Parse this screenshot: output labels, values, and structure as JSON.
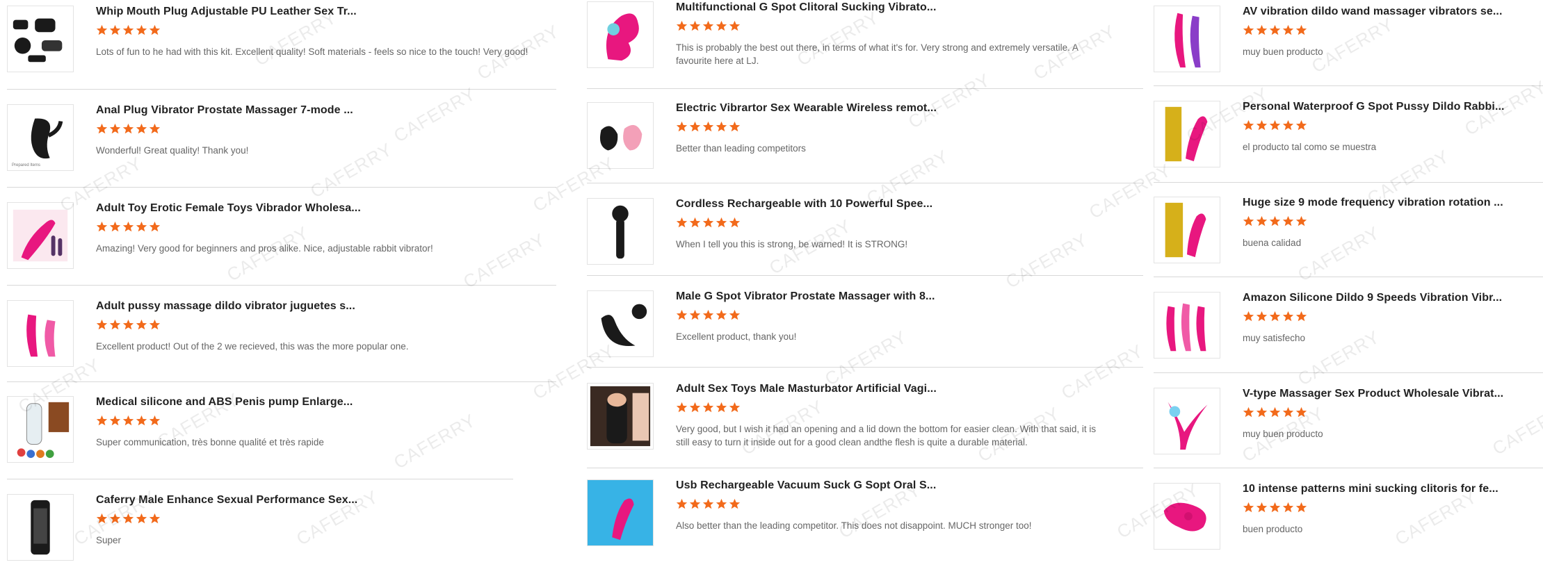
{
  "watermark_text": "CAFERRY",
  "star_color": "#f26a1b",
  "columns": [
    {
      "items": [
        {
          "title": "Whip Mouth Plug Adjustable PU Leather Sex Tr...",
          "rating": 5,
          "review": "Lots of fun to he had with this kit. Excellent quality! Soft materials - feels so nice to the touch! Very good!",
          "image": "black-restraint-kit"
        },
        {
          "title": "Anal Plug Vibrator Prostate Massager 7-mode ...",
          "rating": 5,
          "review": "Wonderful! Great quality! Thank you!",
          "image": "black-prostate-massager",
          "image_caption": "Prepared Items"
        },
        {
          "title": "Adult Toy Erotic Female Toys Vibrador Wholesa...",
          "rating": 5,
          "review": "Amazing! Very good for beginners and pros alike. Nice, adjustable rabbit vibrator!",
          "image": "pink-rabbit-vibrator"
        },
        {
          "title": "Adult pussy massage dildo vibrator juguetes s...",
          "rating": 5,
          "review": "Excellent product! Out of the 2 we recieved, this was the more popular one.",
          "image": "pink-dual-vibrator"
        },
        {
          "title": "Medical silicone and ABS Penis pump Enlarge...",
          "rating": 5,
          "review": "Super communication, très bonne qualité et très rapide",
          "image": "clear-pump-set"
        },
        {
          "title": "Caferry Male Enhance Sexual Performance Sex...",
          "rating": 5,
          "review": "Super",
          "image": "black-pump-cylinder"
        }
      ]
    },
    {
      "items": [
        {
          "title": "Multifunctional G Spot Clitoral Sucking Vibrato...",
          "rating": 5,
          "review": "This is probably the best out there, in terms of what it's for. Very strong and extremely versatile. A favourite here at LJ.",
          "image": "pink-squirrel-vibrator"
        },
        {
          "title": "Electric Vibrartor Sex Wearable Wireless remot...",
          "rating": 5,
          "review": "Better than leading competitors",
          "image": "black-pink-wearable"
        },
        {
          "title": "Cordless Rechargeable with 10 Powerful Spee...",
          "rating": 5,
          "review": "When I tell you this is strong, be warned! It is STRONG!",
          "image": "black-wand"
        },
        {
          "title": "Male G Spot Vibrator Prostate Massager with 8...",
          "rating": 5,
          "review": "Excellent product, thank you!",
          "image": "black-prostate-remote"
        },
        {
          "title": "Adult Sex Toys Male Masturbator Artificial Vagi...",
          "rating": 5,
          "review": "Very good, but I wish it had an opening and a lid down the bottom for easier clean. With that said, it is still easy to turn it inside out for a good clean andthe flesh is quite a durable material.",
          "image": "flesh-masturbator"
        },
        {
          "title": "Usb Rechargeable Vacuum Suck G Sopt Oral S...",
          "rating": 5,
          "review": "Also better than the leading competitor. This does not disappoint. MUCH stronger too!",
          "image": "pink-on-blue-water"
        }
      ]
    },
    {
      "items": [
        {
          "title": "AV vibration dildo wand massager vibrators se...",
          "rating": 5,
          "review": "muy buen producto",
          "image": "purple-pink-wands"
        },
        {
          "title": "Personal Waterproof G Spot Pussy Dildo Rabbi...",
          "rating": 5,
          "review": "el producto tal como se muestra",
          "image": "pink-rabbit-box"
        },
        {
          "title": "Huge size 9 mode frequency vibration rotation ...",
          "rating": 5,
          "review": "buena calidad",
          "image": "pink-rabbit-box-2"
        },
        {
          "title": "Amazon Silicone Dildo 9 Speeds Vibration Vibr...",
          "rating": 5,
          "review": "muy satisfecho",
          "image": "pink-triple-vibrators"
        },
        {
          "title": "V-type Massager Sex Product Wholesale Vibrat...",
          "rating": 5,
          "review": "muy buen producto",
          "image": "pink-v-massager"
        },
        {
          "title": "10 intense patterns mini sucking clitoris for fe...",
          "rating": 5,
          "review": "buen producto",
          "image": "pink-couple-vibrator"
        }
      ]
    }
  ]
}
